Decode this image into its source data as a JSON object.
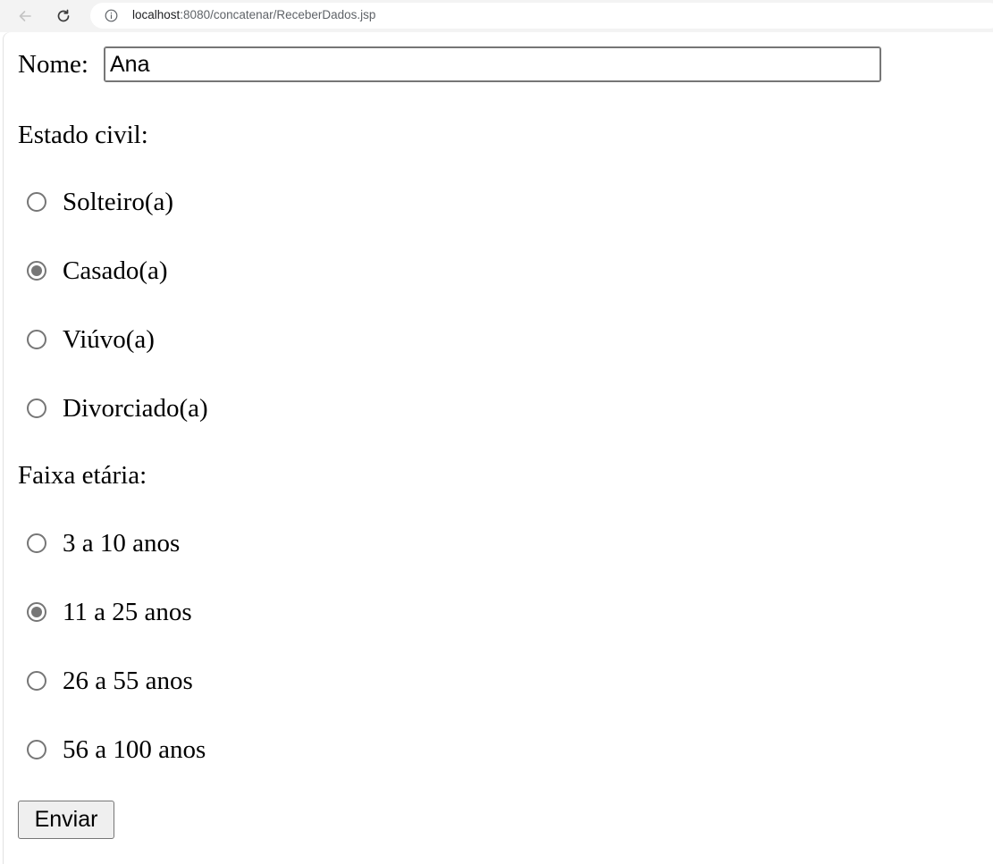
{
  "browser": {
    "url_host": "localhost",
    "url_rest": ":8080/concatenar/ReceberDados.jsp"
  },
  "form": {
    "nome_label": "Nome:",
    "nome_value": "Ana",
    "estado_civil_label": "Estado civil:",
    "estado_civil_options": [
      {
        "label": "Solteiro(a)",
        "checked": false
      },
      {
        "label": "Casado(a)",
        "checked": true
      },
      {
        "label": "Viúvo(a)",
        "checked": false
      },
      {
        "label": "Divorciado(a)",
        "checked": false
      }
    ],
    "faixa_etaria_label": "Faixa etária:",
    "faixa_etaria_options": [
      {
        "label": "3 a 10 anos",
        "checked": false
      },
      {
        "label": "11 a 25 anos",
        "checked": true
      },
      {
        "label": "26 a 55 anos",
        "checked": false
      },
      {
        "label": "56 a 100 anos",
        "checked": false
      }
    ],
    "submit_label": "Enviar"
  },
  "colors": {
    "radio_checked": "#767676",
    "chrome_bg": "#f3f3f3"
  }
}
